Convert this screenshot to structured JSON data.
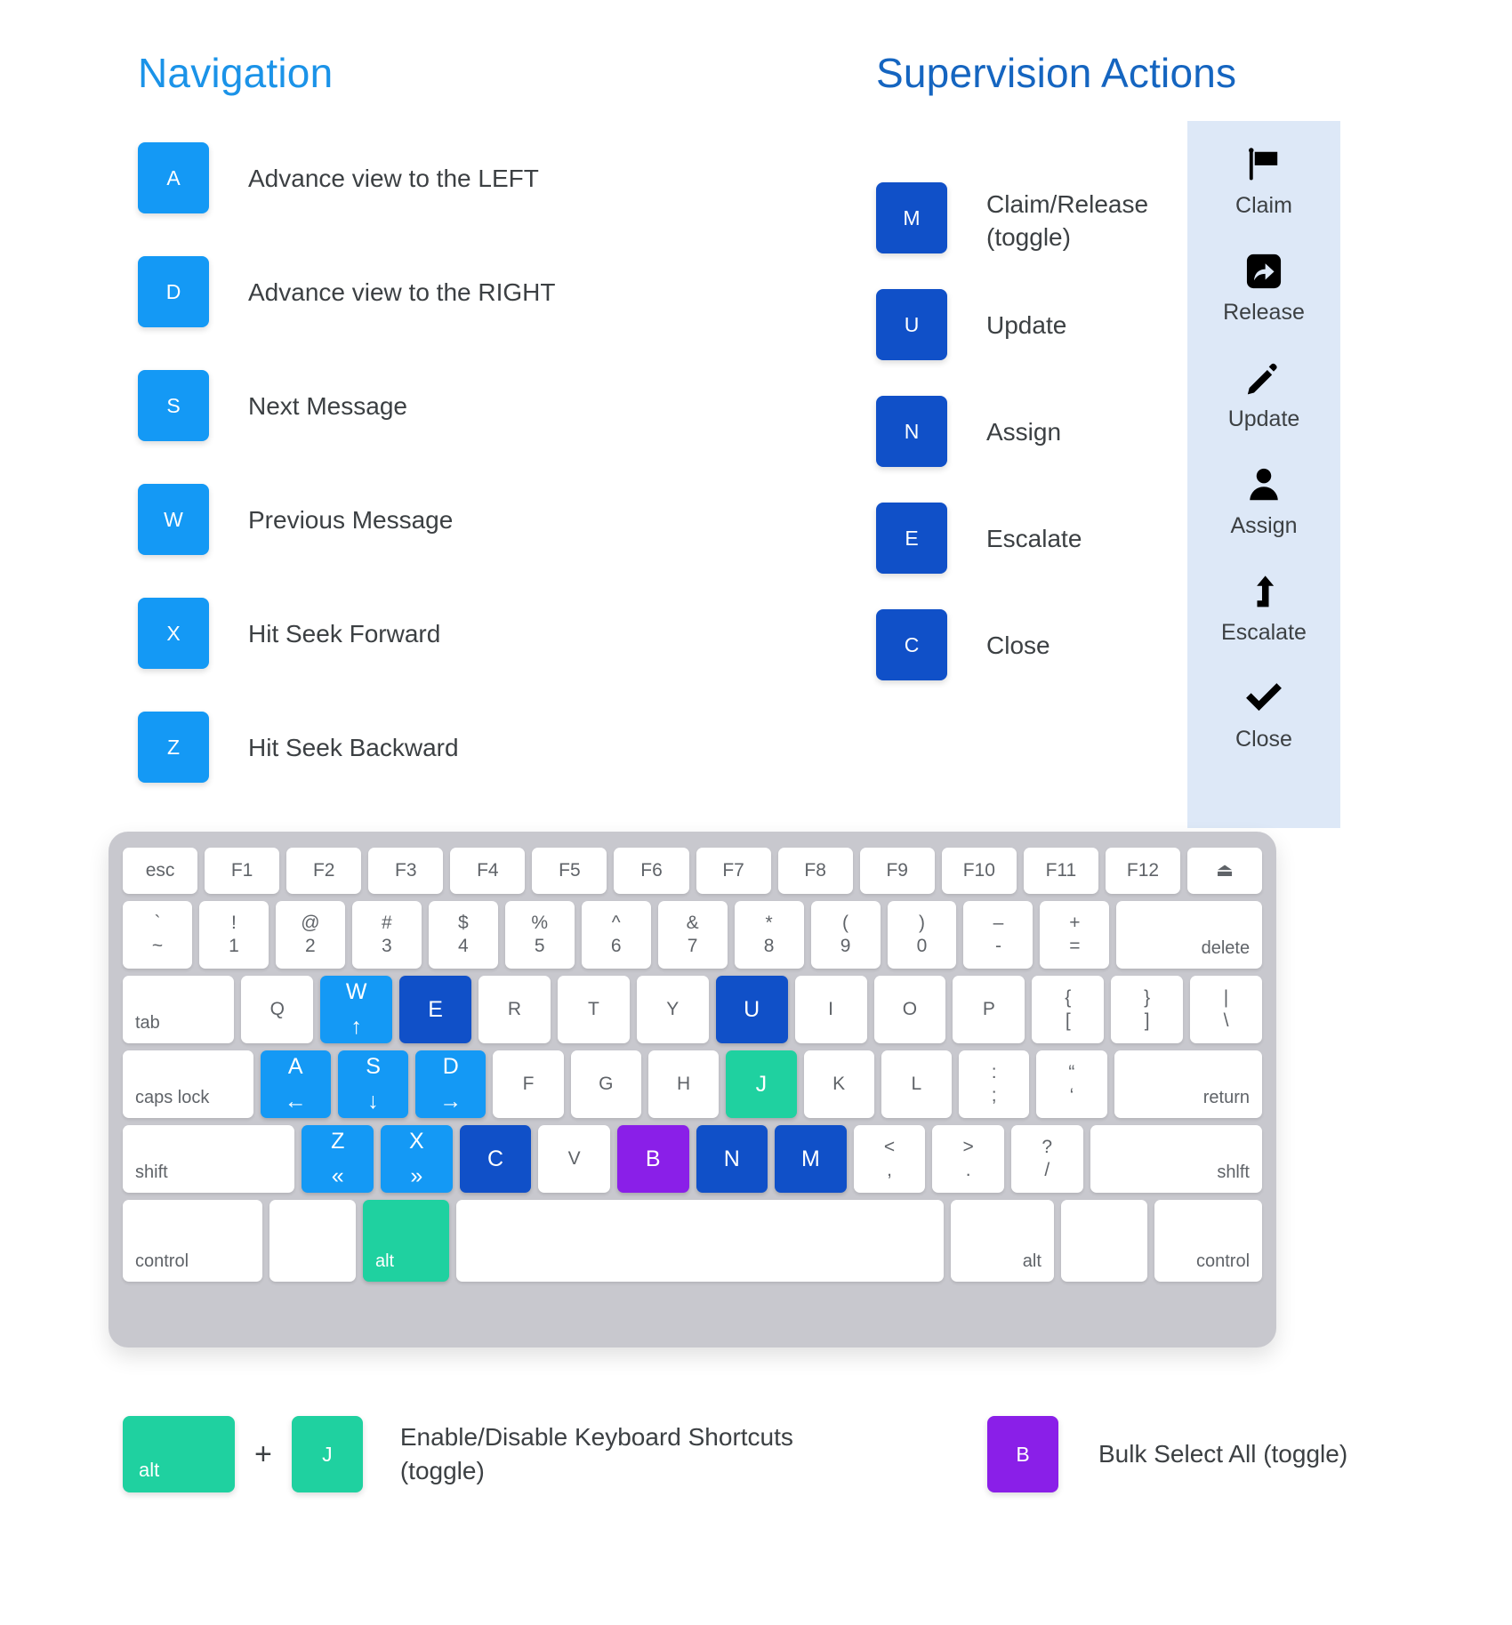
{
  "headings": {
    "navigation": "Navigation",
    "supervision": "Supervision Actions"
  },
  "colors": {
    "light_blue": "#1499f5",
    "dark_blue": "#1050c8",
    "green": "#1fd1a0",
    "purple": "#8a1fe8",
    "rail_background": "#dde8f7",
    "keyboard_body": "#c8c8ce",
    "heading_navigation": "#1b93e8",
    "heading_supervision": "#1565c0"
  },
  "navigation": {
    "items": [
      {
        "key": "A",
        "description": "Advance view to the LEFT",
        "color": "lt"
      },
      {
        "key": "D",
        "description": "Advance view to the RIGHT",
        "color": "lt"
      },
      {
        "key": "S",
        "description": "Next Message",
        "color": "lt"
      },
      {
        "key": "W",
        "description": "Previous Message",
        "color": "lt"
      },
      {
        "key": "X",
        "description": "Hit Seek Forward",
        "color": "lt"
      },
      {
        "key": "Z",
        "description": "Hit Seek Backward",
        "color": "lt"
      }
    ]
  },
  "supervision": {
    "items": [
      {
        "key": "M",
        "description": "Claim/Release\n(toggle)",
        "color": "dk"
      },
      {
        "key": "U",
        "description": "Update",
        "color": "dk"
      },
      {
        "key": "N",
        "description": "Assign",
        "color": "dk"
      },
      {
        "key": "E",
        "description": "Escalate",
        "color": "dk"
      },
      {
        "key": "C",
        "description": "Close",
        "color": "dk"
      }
    ]
  },
  "action_rail": {
    "items": [
      {
        "label": "Claim",
        "icon": "flag-icon"
      },
      {
        "label": "Release",
        "icon": "share-arrow-icon"
      },
      {
        "label": "Update",
        "icon": "pencil-icon"
      },
      {
        "label": "Assign",
        "icon": "person-icon"
      },
      {
        "label": "Escalate",
        "icon": "escalate-arrow-icon"
      },
      {
        "label": "Close",
        "icon": "checkmark-icon"
      }
    ]
  },
  "keyboard": {
    "rows": [
      {
        "id": "r1",
        "keys": [
          {
            "top": "esc",
            "align": "left"
          },
          {
            "top": "F1"
          },
          {
            "top": "F2"
          },
          {
            "top": "F3"
          },
          {
            "top": "F4"
          },
          {
            "top": "F5"
          },
          {
            "top": "F6"
          },
          {
            "top": "F7"
          },
          {
            "top": "F8"
          },
          {
            "top": "F9"
          },
          {
            "top": "F10"
          },
          {
            "top": "F11"
          },
          {
            "top": "F12"
          },
          {
            "top": "⏏"
          }
        ]
      },
      {
        "id": "r2",
        "keys": [
          {
            "top": "`",
            "bot": "~"
          },
          {
            "top": "!",
            "bot": "1"
          },
          {
            "top": "@",
            "bot": "2"
          },
          {
            "top": "#",
            "bot": "3"
          },
          {
            "top": "$",
            "bot": "4"
          },
          {
            "top": "%",
            "bot": "5"
          },
          {
            "top": "^",
            "bot": "6"
          },
          {
            "top": "&",
            "bot": "7"
          },
          {
            "top": "*",
            "bot": "8"
          },
          {
            "top": "(",
            "bot": "9"
          },
          {
            "top": ")",
            "bot": "0"
          },
          {
            "top": "–",
            "bot": "-"
          },
          {
            "top": "+",
            "bot": "="
          },
          {
            "corner_right": "delete",
            "flex": 2.1
          }
        ]
      },
      {
        "id": "r3",
        "keys": [
          {
            "corner": "tab",
            "flex": 1.55
          },
          {
            "top": "Q"
          },
          {
            "top": "W",
            "bot": "↑",
            "color": "lt"
          },
          {
            "top": "E",
            "color": "dk"
          },
          {
            "top": "R"
          },
          {
            "top": "T"
          },
          {
            "top": "Y"
          },
          {
            "top": "U",
            "color": "dk"
          },
          {
            "top": "I"
          },
          {
            "top": "O"
          },
          {
            "top": "P"
          },
          {
            "top": "{",
            "bot": "["
          },
          {
            "top": "}",
            "bot": "]"
          },
          {
            "top": "|",
            "bot": "\\"
          }
        ]
      },
      {
        "id": "r4",
        "keys": [
          {
            "corner": "caps lock",
            "flex": 1.85
          },
          {
            "top": "A",
            "bot": "←",
            "color": "lt"
          },
          {
            "top": "S",
            "bot": "↓",
            "color": "lt"
          },
          {
            "top": "D",
            "bot": "→",
            "color": "lt"
          },
          {
            "top": "F"
          },
          {
            "top": "G"
          },
          {
            "top": "H"
          },
          {
            "top": "J",
            "color": "gr"
          },
          {
            "top": "K"
          },
          {
            "top": "L"
          },
          {
            "top": ":",
            "bot": ";"
          },
          {
            "top": "“",
            "bot": "‘"
          },
          {
            "corner_right": "return",
            "flex": 2.1
          }
        ]
      },
      {
        "id": "r5",
        "keys": [
          {
            "corner": "shift",
            "flex": 2.4
          },
          {
            "top": "Z",
            "bot": "«",
            "color": "lt"
          },
          {
            "top": "X",
            "bot": "»",
            "color": "lt"
          },
          {
            "top": "C",
            "color": "dk"
          },
          {
            "top": "V"
          },
          {
            "top": "B",
            "color": "pu"
          },
          {
            "top": "N",
            "color": "dk"
          },
          {
            "top": "M",
            "color": "dk"
          },
          {
            "top": "<",
            "bot": ","
          },
          {
            "top": ">",
            "bot": "."
          },
          {
            "top": "?",
            "bot": "/"
          },
          {
            "corner_right": "shlft",
            "flex": 2.4
          }
        ]
      },
      {
        "id": "r6",
        "keys": [
          {
            "corner": "control",
            "flex": 1.62
          },
          {
            "flex": 1.0
          },
          {
            "corner": "alt",
            "color": "gr",
            "flex": 1.0
          },
          {
            "flex": 5.65
          },
          {
            "corner_right": "alt",
            "flex": 1.2
          },
          {
            "flex": 1.0
          },
          {
            "corner_right": "control",
            "flex": 1.25
          }
        ]
      }
    ]
  },
  "footer": {
    "left": {
      "key_modifier": "alt",
      "plus": "+",
      "key_letter": "J",
      "description": "Enable/Disable Keyboard Shortcuts\n(toggle)"
    },
    "right": {
      "key_letter": "B",
      "description": "Bulk Select All (toggle)"
    }
  }
}
